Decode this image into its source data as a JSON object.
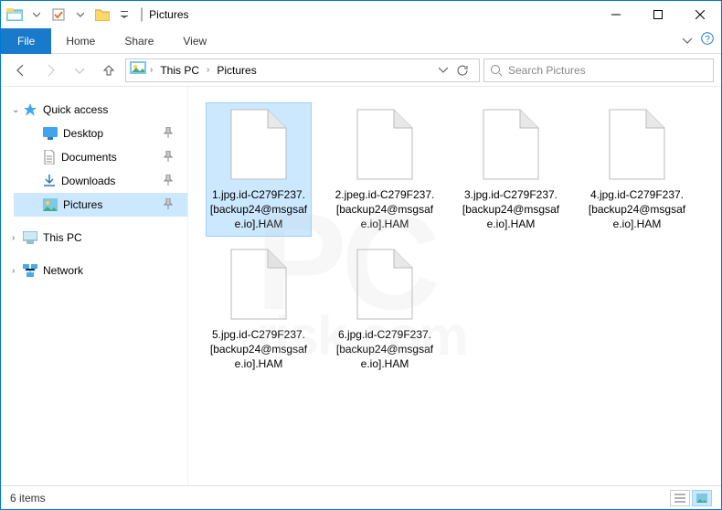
{
  "title": "Pictures",
  "ribbon": {
    "file": "File",
    "tabs": [
      "Home",
      "Share",
      "View"
    ]
  },
  "breadcrumb": {
    "root_chev": "›",
    "pc": "This PC",
    "folder": "Pictures"
  },
  "search": {
    "placeholder": "Search Pictures"
  },
  "sidebar": {
    "quick": "Quick access",
    "items": [
      {
        "label": "Desktop",
        "icon": "desktop"
      },
      {
        "label": "Documents",
        "icon": "documents"
      },
      {
        "label": "Downloads",
        "icon": "downloads"
      },
      {
        "label": "Pictures",
        "icon": "pictures",
        "selected": true
      }
    ],
    "thispc": "This PC",
    "network": "Network"
  },
  "files": [
    {
      "name": "1.jpg.id-C279F237.[backup24@msgsafe.io].HAM",
      "selected": true
    },
    {
      "name": "2.jpeg.id-C279F237.[backup24@msgsafe.io].HAM"
    },
    {
      "name": "3.jpg.id-C279F237.[backup24@msgsafe.io].HAM"
    },
    {
      "name": "4.jpg.id-C279F237.[backup24@msgsafe.io].HAM"
    },
    {
      "name": "5.jpg.id-C279F237.[backup24@msgsafe.io].HAM"
    },
    {
      "name": "6.jpg.id-C279F237.[backup24@msgsafe.io].HAM"
    }
  ],
  "status": {
    "count": "6 items"
  },
  "watermark": {
    "big": "PC",
    "small": "risk.com"
  }
}
